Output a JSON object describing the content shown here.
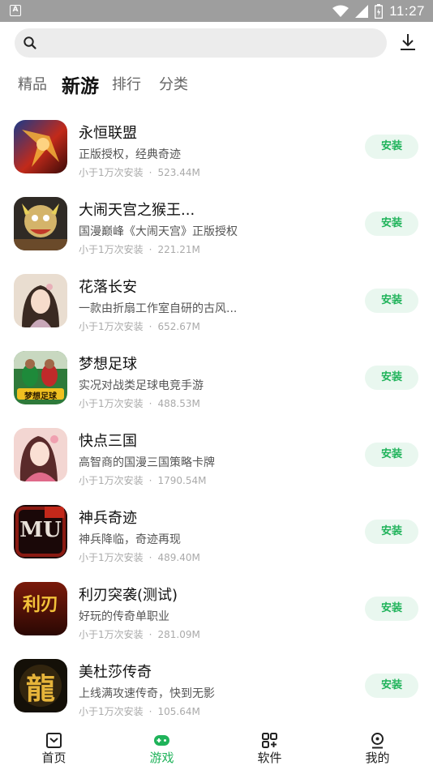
{
  "status_bar": {
    "time": "11:27",
    "notification_glyph": "A"
  },
  "search": {
    "placeholder": ""
  },
  "tabs": [
    {
      "label": "精品",
      "active": false
    },
    {
      "label": "新游",
      "active": true
    },
    {
      "label": "排行",
      "active": false
    },
    {
      "label": "分类",
      "active": false
    }
  ],
  "apps": [
    {
      "name": "永恒联盟",
      "desc": "正版授权，经典奇迹",
      "installs": "小于1万次安装",
      "size": "523.44M",
      "button": "安装"
    },
    {
      "name": "大闹天宫之猴王...",
      "desc": "国漫巅峰《大闹天宫》正版授权",
      "installs": "小于1万次安装",
      "size": "221.21M",
      "button": "安装"
    },
    {
      "name": "花落长安",
      "desc": "一款由折扇工作室自研的古风...",
      "installs": "小于1万次安装",
      "size": "652.67M",
      "button": "安装"
    },
    {
      "name": "梦想足球",
      "desc": "实况对战类足球电竞手游",
      "installs": "小于1万次安装",
      "size": "488.53M",
      "button": "安装"
    },
    {
      "name": "快点三国",
      "desc": "高智商的国漫三国策略卡牌",
      "installs": "小于1万次安装",
      "size": "1790.54M",
      "button": "安装"
    },
    {
      "name": "神兵奇迹",
      "desc": "神兵降临，奇迹再现",
      "installs": "小于1万次安装",
      "size": "489.40M",
      "button": "安装"
    },
    {
      "name": "利刃突袭(测试)",
      "desc": "好玩的传奇单职业",
      "installs": "小于1万次安装",
      "size": "281.09M",
      "button": "安装"
    },
    {
      "name": "美杜莎传奇",
      "desc": "上线满攻速传奇，快到无影",
      "installs": "小于1万次安装",
      "size": "105.64M",
      "button": "安装"
    }
  ],
  "icon_labels": {
    "icon4": "梦想足球",
    "icon6": "MU",
    "icon7": "利刃",
    "icon8": "龍"
  },
  "bottom_nav": [
    {
      "label": "首页",
      "icon": "home-icon",
      "active": false
    },
    {
      "label": "游戏",
      "icon": "gamepad-icon",
      "active": true
    },
    {
      "label": "软件",
      "icon": "apps-icon",
      "active": false
    },
    {
      "label": "我的",
      "icon": "profile-icon",
      "active": false
    }
  ],
  "colors": {
    "accent": "#1fb35a",
    "install_bg": "#e9f7ef",
    "status_bar": "#9e9e9e",
    "search_bg": "#ececec"
  }
}
